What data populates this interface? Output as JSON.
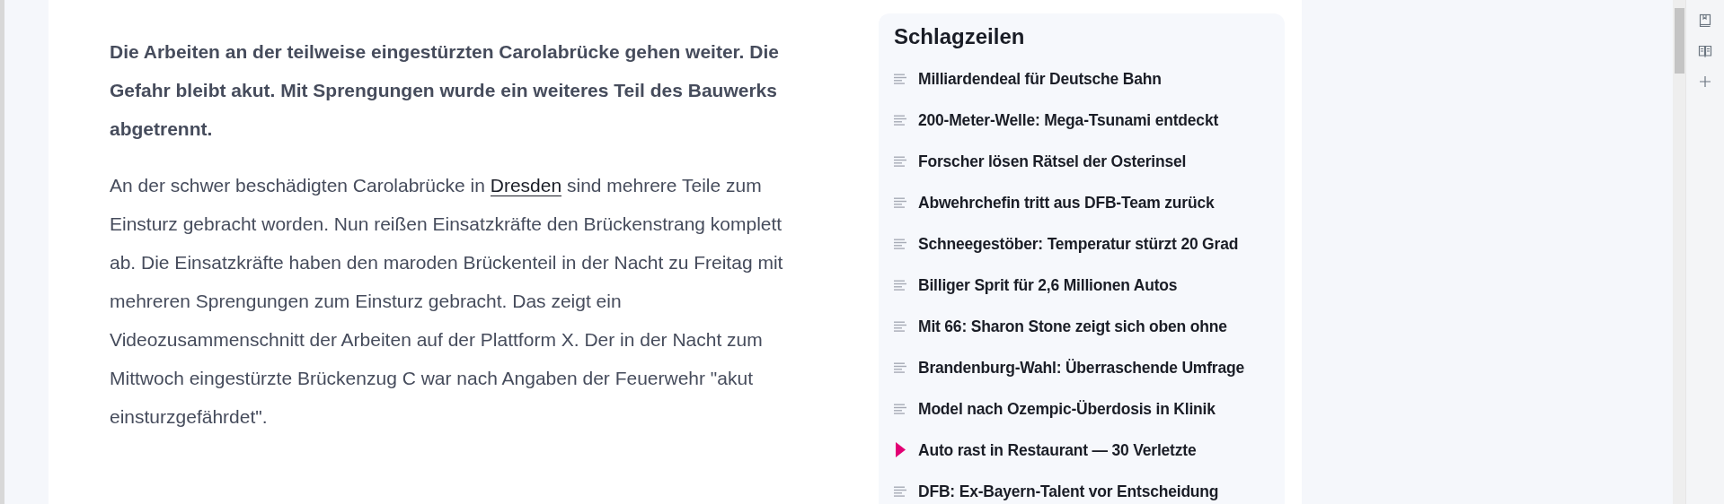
{
  "article": {
    "lead": "Die Arbeiten an der teilweise eingestürzten Carolabrücke gehen weiter. Die Gefahr bleibt akut. Mit Sprengungen wurde ein weiteres Teil des Bauwerks abgetrennt.",
    "paragraph": {
      "before": "An der schwer beschädigten Carolabrücke in",
      "link": "Dresden",
      "after": "sind mehrere Teile zum Einsturz gebracht worden. Nun reißen Einsatzkräfte den Brückenstrang komplett ab. Die Einsatzkräfte haben den maroden Brückenteil in der Nacht zu Freitag mit mehreren Sprengungen zum Einsturz gebracht. Das zeigt ein Videozusammenschnitt der Arbeiten auf der Plattform X. Der in der Nacht zum Mittwoch eingestürzte Brückenzug C war nach Angaben der Feuerwehr \"akut einsturzgefährdet\"."
    }
  },
  "sidebar": {
    "title": "Schlagzeilen",
    "items": [
      {
        "kind": "article",
        "text": "Milliardendeal für Deutsche Bahn"
      },
      {
        "kind": "article",
        "text": "200-Meter-Welle: Mega-Tsunami entdeckt"
      },
      {
        "kind": "article",
        "text": "Forscher lösen Rätsel der Osterinsel"
      },
      {
        "kind": "article",
        "text": "Abwehrchefin tritt aus DFB-Team zurück"
      },
      {
        "kind": "article",
        "text": "Schneegestöber: Temperatur stürzt 20 Grad"
      },
      {
        "kind": "article",
        "text": "Billiger Sprit für 2,6 Millionen Autos"
      },
      {
        "kind": "article",
        "text": "Mit 66: Sharon Stone zeigt sich oben ohne"
      },
      {
        "kind": "article",
        "text": "Brandenburg-Wahl: Überraschende Umfrage"
      },
      {
        "kind": "article",
        "text": "Model nach Ozempic-Überdosis in Klinik"
      },
      {
        "kind": "video",
        "text": "Auto rast in Restaurant — 30 Verletzte"
      },
      {
        "kind": "article",
        "text": "DFB: Ex-Bayern-Talent vor Entscheidung"
      }
    ]
  }
}
